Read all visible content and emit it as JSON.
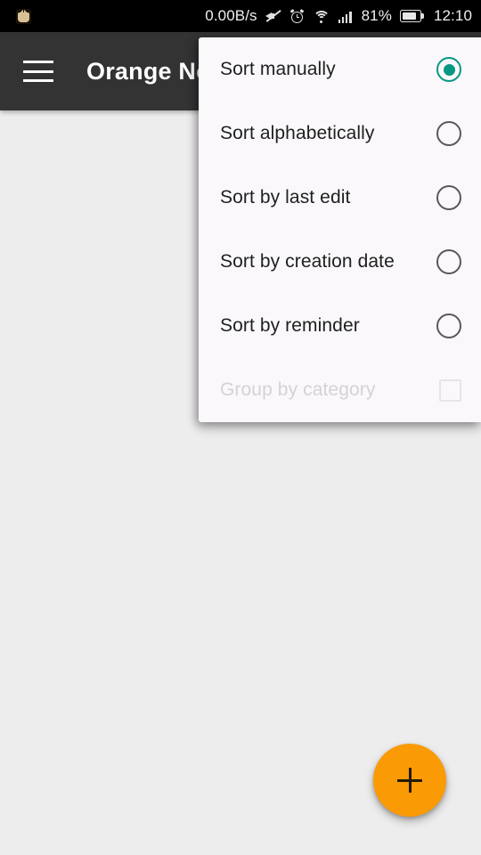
{
  "status_bar": {
    "app_badge_icon": "cat-app-icon",
    "network_speed": "0.00B/s",
    "icons": [
      "mute-speaker-icon",
      "alarm-clock-icon",
      "wifi-icon",
      "signal-bars-icon"
    ],
    "battery_percent": "81%",
    "battery_level": 81,
    "battery_icon": "battery-icon",
    "clock": "12:10"
  },
  "app_bar": {
    "menu_icon": "hamburger-menu-icon",
    "title": "Orange Notes",
    "background_color": "#333333"
  },
  "popup_menu": {
    "items": [
      {
        "label": "Sort manually",
        "control": "radio",
        "selected": true,
        "disabled": false
      },
      {
        "label": "Sort alphabetically",
        "control": "radio",
        "selected": false,
        "disabled": false
      },
      {
        "label": "Sort by last edit",
        "control": "radio",
        "selected": false,
        "disabled": false
      },
      {
        "label": "Sort by creation date",
        "control": "radio",
        "selected": false,
        "disabled": false
      },
      {
        "label": "Sort by reminder",
        "control": "radio",
        "selected": false,
        "disabled": false
      },
      {
        "label": "Group by category",
        "control": "checkbox",
        "selected": false,
        "disabled": true
      }
    ],
    "accent_color": "#059983",
    "background_color": "#FAF8FB"
  },
  "fab": {
    "icon": "plus-icon",
    "label": "Add note",
    "color": "#FA9A05"
  },
  "page_background": "#EDEDED"
}
